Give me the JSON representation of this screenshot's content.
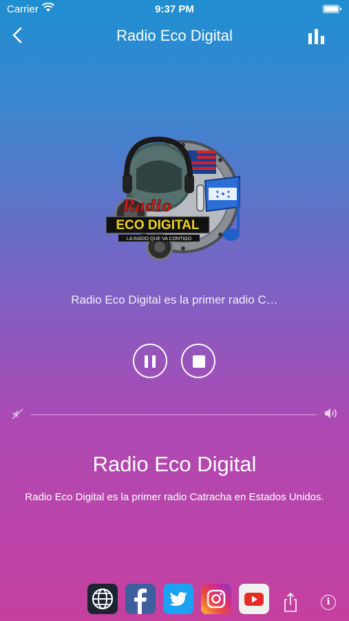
{
  "status": {
    "carrier": "Carrier",
    "time": "9:37 PM"
  },
  "nav": {
    "title": "Radio Eco Digital"
  },
  "logo": {
    "top_text": "Radio",
    "main_text": "ECO DIGITAL",
    "tagline": "LA RADIO QUE VA CONTIGO"
  },
  "player": {
    "now_playing": "Radio Eco Digital es la primer radio C…",
    "volume_level": 0
  },
  "station": {
    "title": "Radio Eco Digital",
    "description": "Radio Eco Digital es la primer radio Catracha en Estados Unidos."
  },
  "social": [
    {
      "icon": "globe-icon"
    },
    {
      "icon": "facebook-icon"
    },
    {
      "icon": "twitter-icon"
    },
    {
      "icon": "instagram-icon"
    },
    {
      "icon": "youtube-icon"
    }
  ],
  "colors": {
    "gradient_top": "#1f8ed0",
    "gradient_bottom": "#c5409f"
  }
}
